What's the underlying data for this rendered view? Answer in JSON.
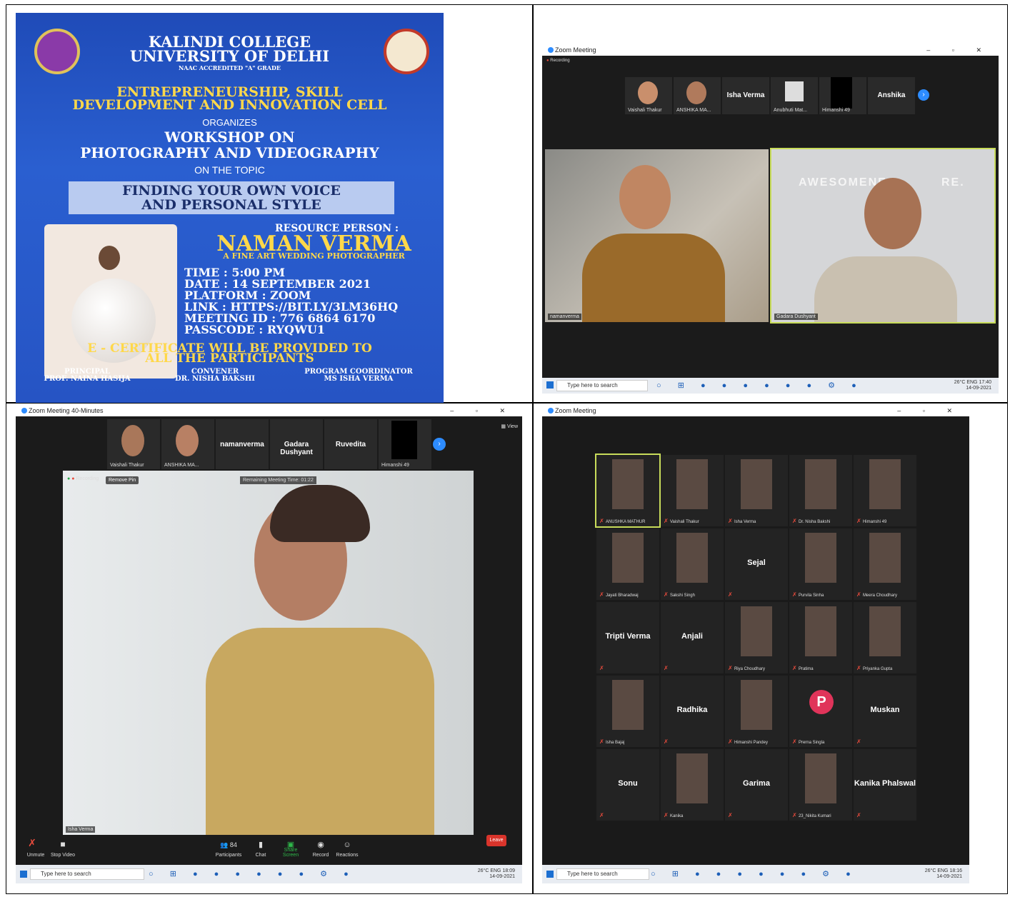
{
  "poster": {
    "college": "KALINDI COLLEGE",
    "university": "UNIVERSITY OF DELHI",
    "naac": "NAAC ACCREDITED \"A\" GRADE",
    "cell_line1": "ENTREPRENEURSHIP, SKILL",
    "cell_line2": "DEVELOPMENT AND INNOVATION CELL",
    "organizes": "ORGANIZES",
    "workshop_line1": "WORKSHOP ON",
    "workshop_line2": "PHOTOGRAPHY AND VIDEOGRAPHY",
    "on_topic": "ON THE TOPIC",
    "topic_line1": "FINDING YOUR OWN VOICE",
    "topic_line2": "AND PERSONAL STYLE",
    "resource_label": "RESOURCE PERSON :",
    "resource_name": "NAMAN VERMA",
    "resource_title": "A FINE ART WEDDING PHOTOGRAPHER",
    "time": "TIME : 5:00 PM",
    "date": "DATE : 14 SEPTEMBER 2021",
    "platform": "PLATFORM : ZOOM",
    "link": "LINK : HTTPS://BIT.LY/3LM36HQ",
    "meeting_id": "MEETING ID : 776 6864 6170",
    "passcode": "PASSCODE : RYQWU1",
    "certificate_line1": "E - CERTIFICATE WILL BE PROVIDED TO",
    "certificate_line2": "ALL THE PARTICIPANTS",
    "principal_role": "PRINCIPAL",
    "principal_name": "PROF. NAINA HASIJA",
    "convener_role": "CONVENER",
    "convener_name": "DR. NISHA BAKSHI",
    "coordinator_role": "PROGRAM COORDINATOR",
    "coordinator_name": "MS ISHA VERMA"
  },
  "zoom1": {
    "title": "Zoom Meeting",
    "recording": "Recording",
    "strip": [
      "Vaishali Thakur",
      "ANSHIKA MA...",
      "Isha Verma",
      "Anubhuti Mat...",
      "Himanshi 49",
      "Anshika"
    ],
    "video_left": "namanverma",
    "video_right": "Gadara Dushyant",
    "wall_text": "AWESOMENE",
    "wall_text2": "RE.",
    "search": "Type here to search",
    "tray": "26°C  ENG",
    "clock": "17:40",
    "date": "14-09-2021"
  },
  "zoom2": {
    "title": "Zoom Meeting 40-Minutes",
    "view": "View",
    "strip": [
      "Vaishali Thakur",
      "ANSHIKA MA...",
      "namanverma",
      "Gadara Dushyant",
      "Ruvedita",
      "Himanshi 49"
    ],
    "recording": "Recording",
    "remove_pin": "Remove Pin",
    "remaining": "Remaining Meeting Time: 01:22",
    "speaker": "Isha Verma",
    "participants_count": "84",
    "controls": [
      "Unmute",
      "Stop Video",
      "Participants",
      "Chat",
      "Share Screen",
      "Record",
      "Reactions"
    ],
    "leave": "Leave",
    "search": "Type here to search",
    "tray": "26°C  ENG",
    "clock": "18:09",
    "date": "14-09-2021"
  },
  "zoom3": {
    "title": "Zoom Meeting",
    "tiles": [
      {
        "label": "ANUSHKA MATHUR",
        "name": ""
      },
      {
        "label": "Vaishali Thakur",
        "name": ""
      },
      {
        "label": "Isha Verma",
        "name": ""
      },
      {
        "label": "Dr. Nisha Bakshi",
        "name": ""
      },
      {
        "label": "Himanshi 49",
        "name": ""
      },
      {
        "label": "Jayati Bharadwaj",
        "name": ""
      },
      {
        "label": "Sakshi Singh",
        "name": ""
      },
      {
        "label": "",
        "name": "Sejal"
      },
      {
        "label": "Purvila Sinha",
        "name": ""
      },
      {
        "label": "Meera Choudhary",
        "name": ""
      },
      {
        "label": "",
        "name": "Tripti Verma"
      },
      {
        "label": "",
        "name": "Anjali"
      },
      {
        "label": "Riya Choudhary",
        "name": ""
      },
      {
        "label": "Pratima",
        "name": ""
      },
      {
        "label": "Priyanka Gupta",
        "name": ""
      },
      {
        "label": "Isha Bajaj",
        "name": ""
      },
      {
        "label": "",
        "name": "Radhika"
      },
      {
        "label": "Himanshi Pandey",
        "name": ""
      },
      {
        "label": "Prerna Singla",
        "name": ""
      },
      {
        "label": "",
        "name": "Muskan"
      },
      {
        "label": "",
        "name": "Sonu"
      },
      {
        "label": "Kanika",
        "name": ""
      },
      {
        "label": "",
        "name": "Garima"
      },
      {
        "label": "23_Nikita Kumari",
        "name": ""
      },
      {
        "label": "",
        "name": "Kanika Phalswal"
      }
    ],
    "avatar_letter": "P",
    "search": "Type here to search",
    "tray": "26°C  ENG",
    "clock": "18:16",
    "date": "14-09-2021"
  }
}
